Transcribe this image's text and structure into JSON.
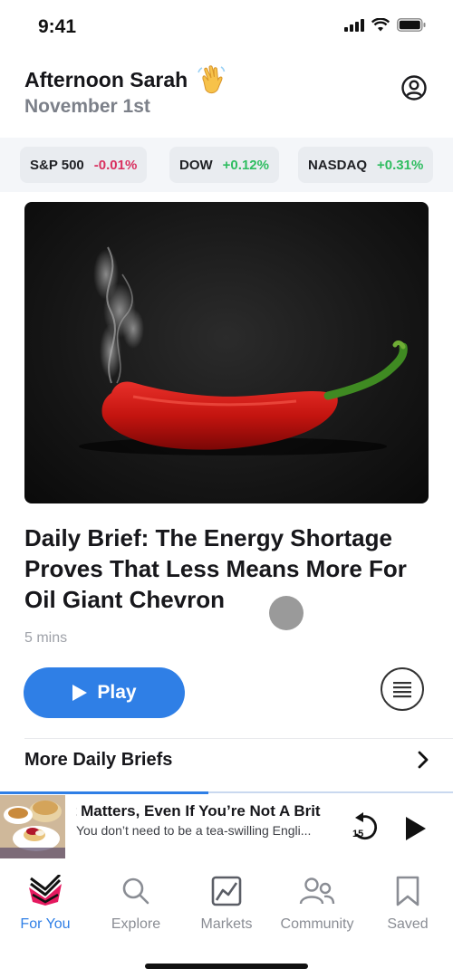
{
  "status_bar": {
    "time": "9:41"
  },
  "header": {
    "greeting": "Afternoon Sarah",
    "date": "November 1st"
  },
  "tickers": [
    {
      "name": "S&P 500",
      "change": "-0.01%",
      "direction": "down"
    },
    {
      "name": "DOW",
      "change": "+0.12%",
      "direction": "up"
    },
    {
      "name": "NASDAQ",
      "change": "+0.31%",
      "direction": "up"
    }
  ],
  "article": {
    "title": "Daily Brief: The Energy Shortage Proves That Less Means More For Oil Giant Chevron",
    "duration": "5 mins",
    "play_label": "Play"
  },
  "more_briefs": {
    "label": "More Daily Briefs"
  },
  "player": {
    "title": "’t Matters, Even If You’re Not A Brit",
    "subtitle": "You don’t need to be a tea-swilling Engli...",
    "rewind_seconds": "15",
    "progress": 0.46
  },
  "tabs": [
    {
      "label": "For You",
      "icon": "for-you-icon",
      "active": true
    },
    {
      "label": "Explore",
      "icon": "search-icon",
      "active": false
    },
    {
      "label": "Markets",
      "icon": "chart-icon",
      "active": false
    },
    {
      "label": "Community",
      "icon": "people-icon",
      "active": false
    },
    {
      "label": "Saved",
      "icon": "bookmark-icon",
      "active": false
    }
  ],
  "colors": {
    "accent": "#2f7fe6",
    "negative": "#d9305f",
    "positive": "#2fbd60"
  }
}
